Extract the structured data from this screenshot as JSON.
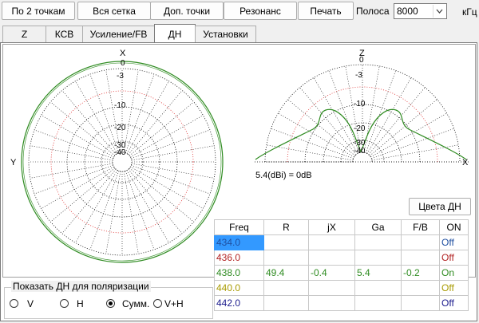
{
  "toolbar": {
    "by_two_points": "По 2 точкам",
    "whole_grid": "Вся сетка",
    "extra_points": "Доп. точки",
    "resonance": "Резонанс",
    "print": "Печать",
    "band_label": "Полоса",
    "band_value": "8000",
    "band_unit": "кГц"
  },
  "tabs": [
    "Z",
    "КСВ",
    "Усиление/FB",
    "ДН",
    "Установки"
  ],
  "active_tab": "ДН",
  "polar_left": {
    "top_label": "X",
    "left_label": "Y",
    "ring_labels": [
      "0",
      "-3",
      "-10",
      "-20",
      "-30",
      "-40"
    ]
  },
  "polar_right": {
    "top_label": "Z",
    "right_label": "X",
    "ring_labels": [
      "0",
      "-3",
      "-10",
      "-20",
      "-30",
      "-40"
    ],
    "gain_note": "5.4(dBi) = 0dB"
  },
  "colors_button": "Цвета ДН",
  "table": {
    "headers": [
      "Freq",
      "R",
      "jX",
      "Ga",
      "F/B",
      "ON"
    ],
    "rows": [
      {
        "freq": "434.0",
        "r": "",
        "jx": "",
        "ga": "",
        "fb": "",
        "on": "Off",
        "color": "#1f4fa0",
        "selected": true
      },
      {
        "freq": "436.0",
        "r": "",
        "jx": "",
        "ga": "",
        "fb": "",
        "on": "Off",
        "color": "#b22222"
      },
      {
        "freq": "438.0",
        "r": "49.4",
        "jx": "-0.4",
        "ga": "5.4",
        "fb": "-0.2",
        "on": "On",
        "color": "#2e8b20"
      },
      {
        "freq": "440.0",
        "r": "",
        "jx": "",
        "ga": "",
        "fb": "",
        "on": "Off",
        "color": "#a89a00"
      },
      {
        "freq": "442.0",
        "r": "",
        "jx": "",
        "ga": "",
        "fb": "",
        "on": "Off",
        "color": "#1a1a8c"
      }
    ]
  },
  "polarization": {
    "title": "Показать ДН для поляризации",
    "options": [
      "V",
      "H",
      "Сумм.",
      "V+H"
    ],
    "selected": "Сумм."
  }
}
